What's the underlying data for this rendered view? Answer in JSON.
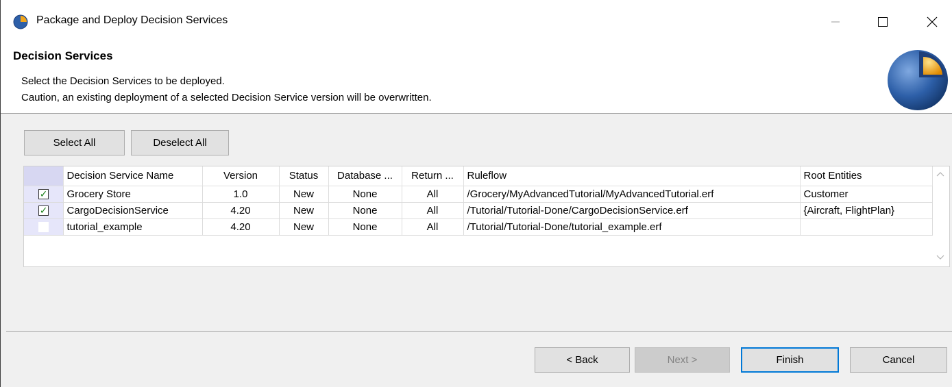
{
  "window": {
    "title": "Package and Deploy Decision Services",
    "minimize_symbol": "—",
    "maximize_symbol": "☐",
    "close_symbol": "✕"
  },
  "header": {
    "title": "Decision Services",
    "line1": "Select the Decision Services to be deployed.",
    "line2": "Caution, an existing deployment of a selected Decision Service version will be overwritten."
  },
  "actions": {
    "select_all": "Select All",
    "deselect_all": "Deselect All"
  },
  "table": {
    "columns": [
      "Decision Service Name",
      "Version",
      "Status",
      "Database ...",
      "Return ...",
      "Ruleflow",
      "Root Entities"
    ],
    "rows": [
      {
        "checked": true,
        "name": "Grocery Store",
        "version": "1.0",
        "status": "New",
        "database": "None",
        "return": "All",
        "ruleflow": "/Grocery/MyAdvancedTutorial/MyAdvancedTutorial.erf",
        "root_entities": "Customer"
      },
      {
        "checked": true,
        "name": "CargoDecisionService",
        "version": "4.20",
        "status": "New",
        "database": "None",
        "return": "All",
        "ruleflow": "/Tutorial/Tutorial-Done/CargoDecisionService.erf",
        "root_entities": "{Aircraft, FlightPlan}"
      },
      {
        "checked": false,
        "name": "tutorial_example",
        "version": "4.20",
        "status": "New",
        "database": "None",
        "return": "All",
        "ruleflow": "/Tutorial/Tutorial-Done/tutorial_example.erf",
        "root_entities": ""
      }
    ]
  },
  "footer": {
    "back": "< Back",
    "next": "Next >",
    "finish": "Finish",
    "cancel": "Cancel"
  },
  "icons": {
    "app": "pie-chart-logo-icon",
    "banner": "pie-chart-logo-icon",
    "scroll_up": "chevron-up-icon",
    "scroll_down": "chevron-down-icon",
    "check": "checkmark-icon"
  },
  "colors": {
    "accent": "#0078d7",
    "logo_blue": "#2d5fa8",
    "logo_orange": "#f2a51a",
    "check_green": "#1a7f1a",
    "check_column_bg": "#e6e6fa"
  }
}
